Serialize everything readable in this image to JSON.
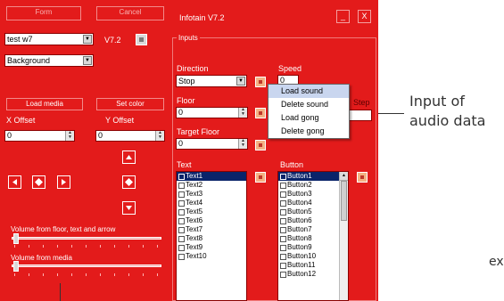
{
  "left_panel": {
    "top_button_1": "Form",
    "top_button_2": "Cancel",
    "combo_project": "test w7",
    "version": "V7.2",
    "combo_mode": "Background",
    "load_media": "Load media",
    "set_color": "Set color",
    "x_offset_label": "X Offset",
    "y_offset_label": "Y Offset",
    "x_offset_value": "0",
    "y_offset_value": "0",
    "volume_floor_label": "Volume from floor, text and arrow",
    "volume_media_label": "Volume from media"
  },
  "window": {
    "title": "Infotain V7.2",
    "min_label": "_",
    "close_label": "X",
    "group_title": "Inputs"
  },
  "inputs": {
    "direction_label": "Direction",
    "direction_value": "Stop",
    "speed_label": "Speed",
    "speed_value": "0",
    "floor_label": "Floor",
    "floor_value": "0",
    "target_floor_label": "Target Floor",
    "target_floor_value": "0",
    "step_label": "Step",
    "text_label": "Text",
    "button_label": "Button"
  },
  "text_list": [
    "Text1",
    "Text2",
    "Text3",
    "Text4",
    "Text5",
    "Text6",
    "Text7",
    "Text8",
    "Text9",
    "Text10"
  ],
  "button_list": [
    "Button1",
    "Button2",
    "Button3",
    "Button4",
    "Button5",
    "Button6",
    "Button7",
    "Button8",
    "Button9",
    "Button10",
    "Button11",
    "Button12"
  ],
  "context_menu": {
    "items": [
      "Load sound",
      "Delete sound",
      "Load gong",
      "Delete gong"
    ]
  },
  "annotation": {
    "line1": "Input of",
    "line2": "audio data",
    "edge_text": "ex"
  },
  "colors": {
    "app_background": "#e31b1b",
    "selection": "#0a246a"
  }
}
